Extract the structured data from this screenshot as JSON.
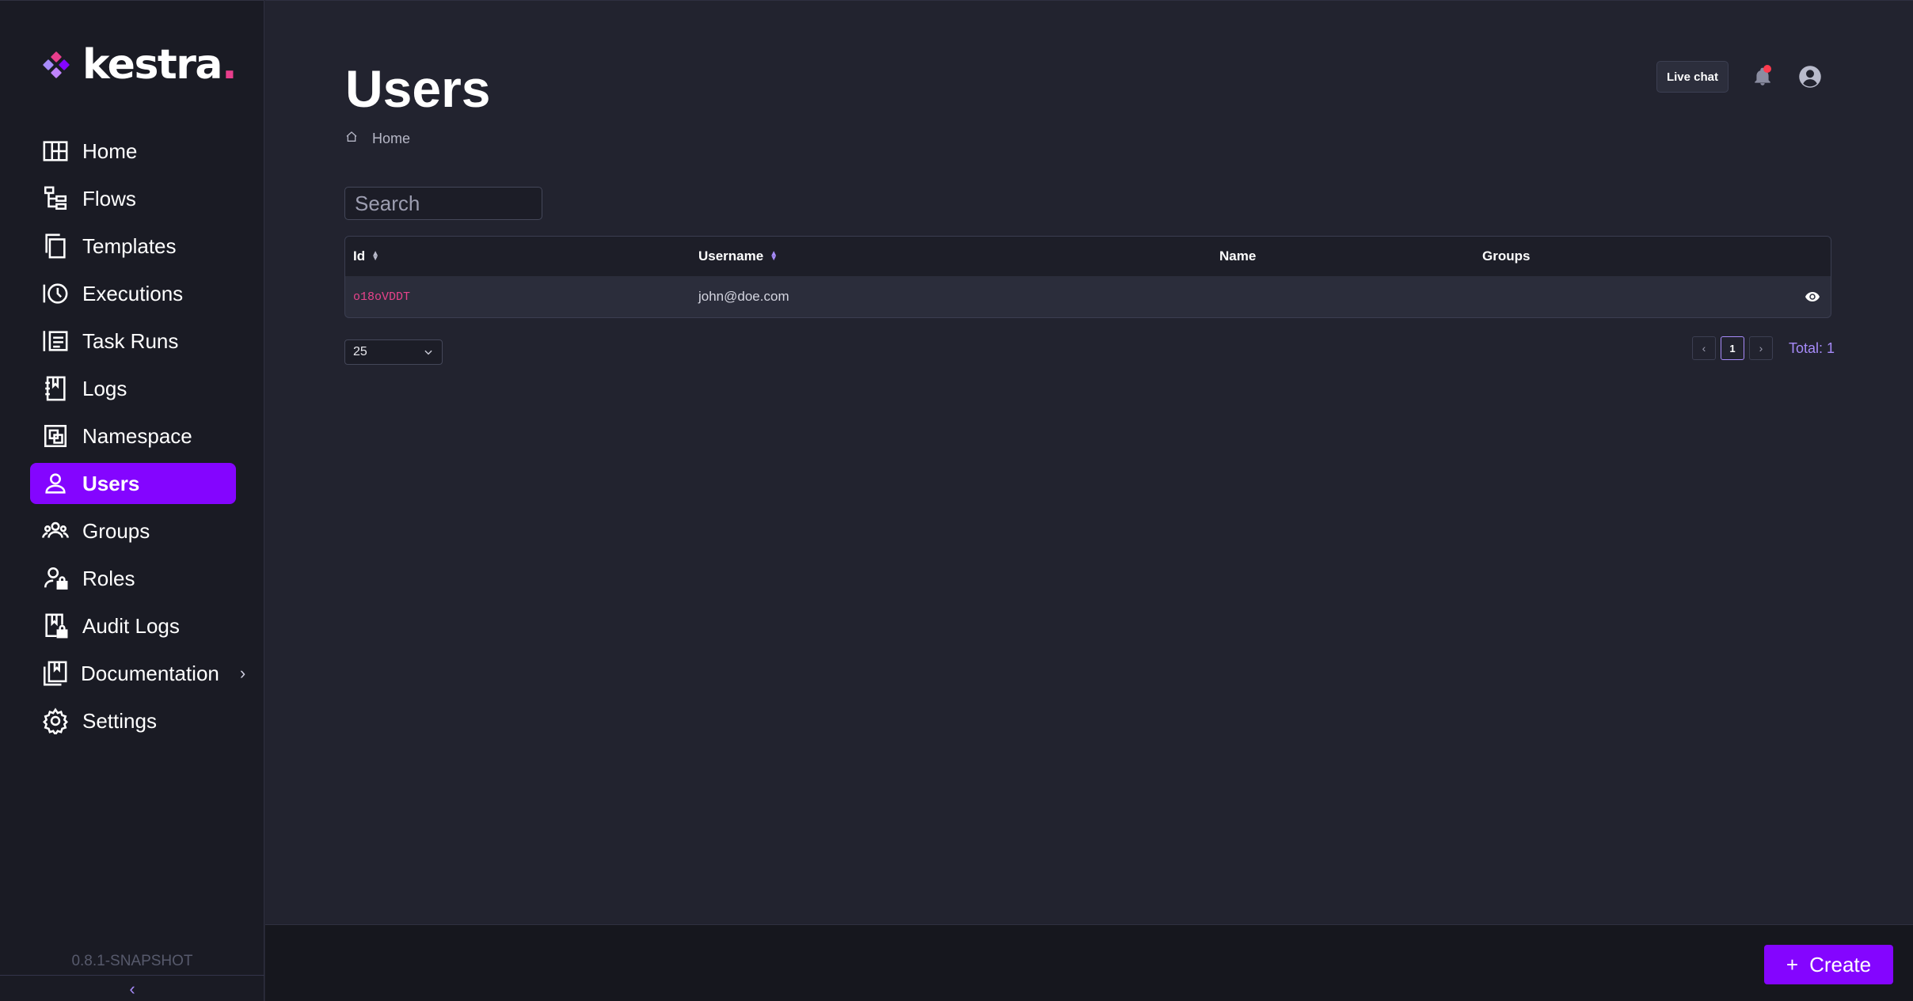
{
  "app": {
    "logo_text": "kestra",
    "logo_dot": ".",
    "version": "0.8.1-SNAPSHOT",
    "brand_color": "#8405ff",
    "accent_pink": "#e83e8c"
  },
  "sidebar": {
    "items": [
      {
        "label": "Home",
        "icon": "home-icon"
      },
      {
        "label": "Flows",
        "icon": "flows-icon"
      },
      {
        "label": "Templates",
        "icon": "templates-icon"
      },
      {
        "label": "Executions",
        "icon": "executions-icon"
      },
      {
        "label": "Task Runs",
        "icon": "task-runs-icon"
      },
      {
        "label": "Logs",
        "icon": "logs-icon"
      },
      {
        "label": "Namespace",
        "icon": "namespace-icon"
      },
      {
        "label": "Users",
        "icon": "user-icon",
        "active": true
      },
      {
        "label": "Groups",
        "icon": "groups-icon"
      },
      {
        "label": "Roles",
        "icon": "roles-icon"
      },
      {
        "label": "Audit Logs",
        "icon": "audit-logs-icon"
      },
      {
        "label": "Documentation",
        "icon": "documentation-icon",
        "has_submenu": true
      },
      {
        "label": "Settings",
        "icon": "settings-icon"
      }
    ]
  },
  "header": {
    "title": "Users",
    "breadcrumb": "Home",
    "live_chat": "Live chat"
  },
  "search": {
    "placeholder": "Search",
    "value": ""
  },
  "table": {
    "columns": {
      "id": "Id",
      "username": "Username",
      "name": "Name",
      "groups": "Groups"
    },
    "rows": [
      {
        "id": "o18oVDDT",
        "username": "john@doe.com",
        "name": "",
        "groups": ""
      }
    ]
  },
  "pagination": {
    "page_size": "25",
    "current_page": "1",
    "total": "Total: 1"
  },
  "footer": {
    "create_label": "Create",
    "create_icon": "+"
  }
}
